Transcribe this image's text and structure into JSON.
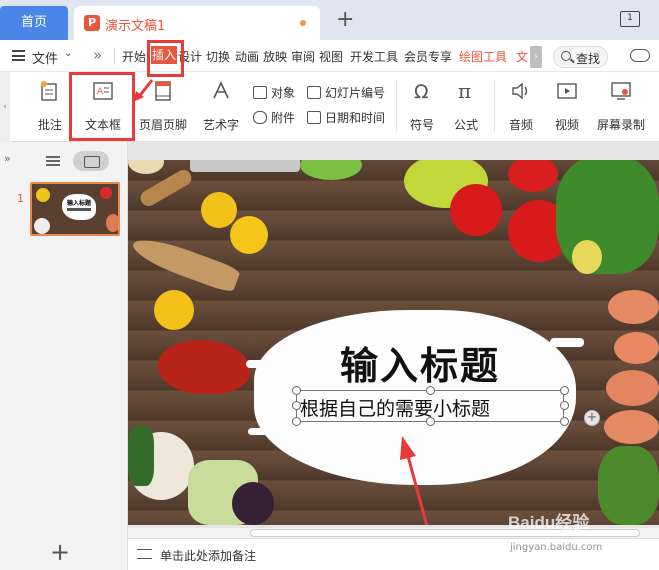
{
  "tabs": {
    "home": "首页",
    "doc_title": "演示文稿1",
    "new_tab": "+",
    "window_badge": "1"
  },
  "menu": {
    "file": "文件",
    "more": "»",
    "items": [
      "开始",
      "插入",
      "设计",
      "切换",
      "动画",
      "放映",
      "审阅",
      "视图",
      "开发工具",
      "会员专享",
      "绘图工具",
      "文"
    ],
    "active_index": 1,
    "search": "查找"
  },
  "ribbon": {
    "comment": "批注",
    "textbox": "文本框",
    "header_footer": "页眉页脚",
    "wordart": "艺术字",
    "object": "对象",
    "attachment": "附件",
    "slide_number": "幻灯片编号",
    "datetime": "日期和时间",
    "symbol": "符号",
    "formula": "公式",
    "audio": "音频",
    "video": "视频",
    "screen_record": "屏幕录制"
  },
  "panel": {
    "collapse": "»",
    "slide_number": "1",
    "thumb_title": "输入标题",
    "add": "+"
  },
  "slide": {
    "title": "输入标题",
    "subtitle": "根据自己的需要小标题"
  },
  "notes": {
    "placeholder": "单击此处添加备注"
  },
  "watermark": {
    "main": "Baidu经验",
    "sub": "jingyan.baidu.com"
  },
  "colors": {
    "accent": "#e8563d",
    "highlight": "#e83a3a",
    "home_tab": "#4a86e8"
  }
}
